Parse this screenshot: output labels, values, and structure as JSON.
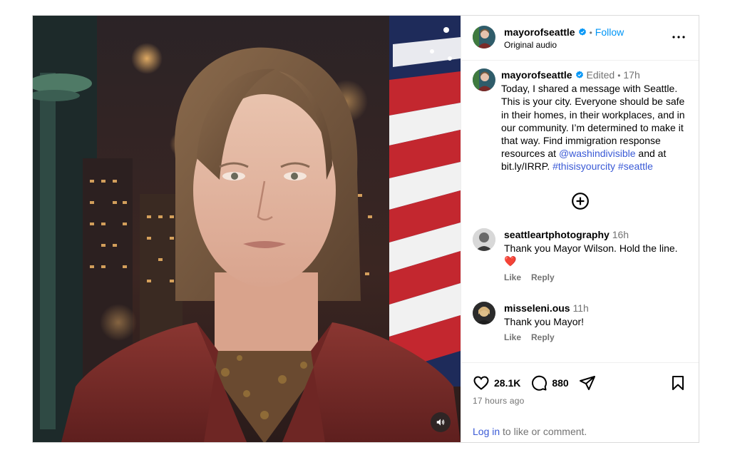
{
  "header": {
    "username": "mayorofseattle",
    "separator": "•",
    "follow_label": "Follow",
    "audio_label": "Original audio"
  },
  "caption": {
    "username": "mayorofseattle",
    "edited": "Edited",
    "separator": "•",
    "time": "17h",
    "text_1": "Today, I shared a message with Seattle. This is your city. Everyone should be safe in their homes, in their workplaces, and in our community. I’m determined to make it that way. Find immigration response resources at ",
    "mention": "@washindivisible",
    "text_2": " and at bit.ly/IRRP. ",
    "hashtag_1": "#thisisyourcity",
    "hashtag_2": "#seattle"
  },
  "comments": [
    {
      "username": "seattleartphotography",
      "time": "16h",
      "text": "Thank you Mayor Wilson. Hold the line.",
      "emoji": "❤️",
      "like_label": "Like",
      "reply_label": "Reply"
    },
    {
      "username": "misseleni.ous",
      "time": "11h",
      "text": "Thank you Mayor!",
      "like_label": "Like",
      "reply_label": "Reply"
    }
  ],
  "footer": {
    "likes": "28.1K",
    "comments": "880",
    "time_ago": "17 hours ago",
    "login_label": "Log in",
    "login_suffix": " to like or comment."
  },
  "icons": {
    "verified": "verified-badge-icon",
    "more": "more-options-icon",
    "add": "add-circle-icon",
    "like": "heart-icon",
    "comment": "comment-bubble-icon",
    "share": "share-icon",
    "save": "bookmark-icon",
    "mute": "speaker-icon"
  },
  "colors": {
    "link": "#3a5ad6",
    "follow": "#0095f6",
    "verified": "#0095f6",
    "muted": "#737373",
    "border": "#dbdbdb"
  }
}
